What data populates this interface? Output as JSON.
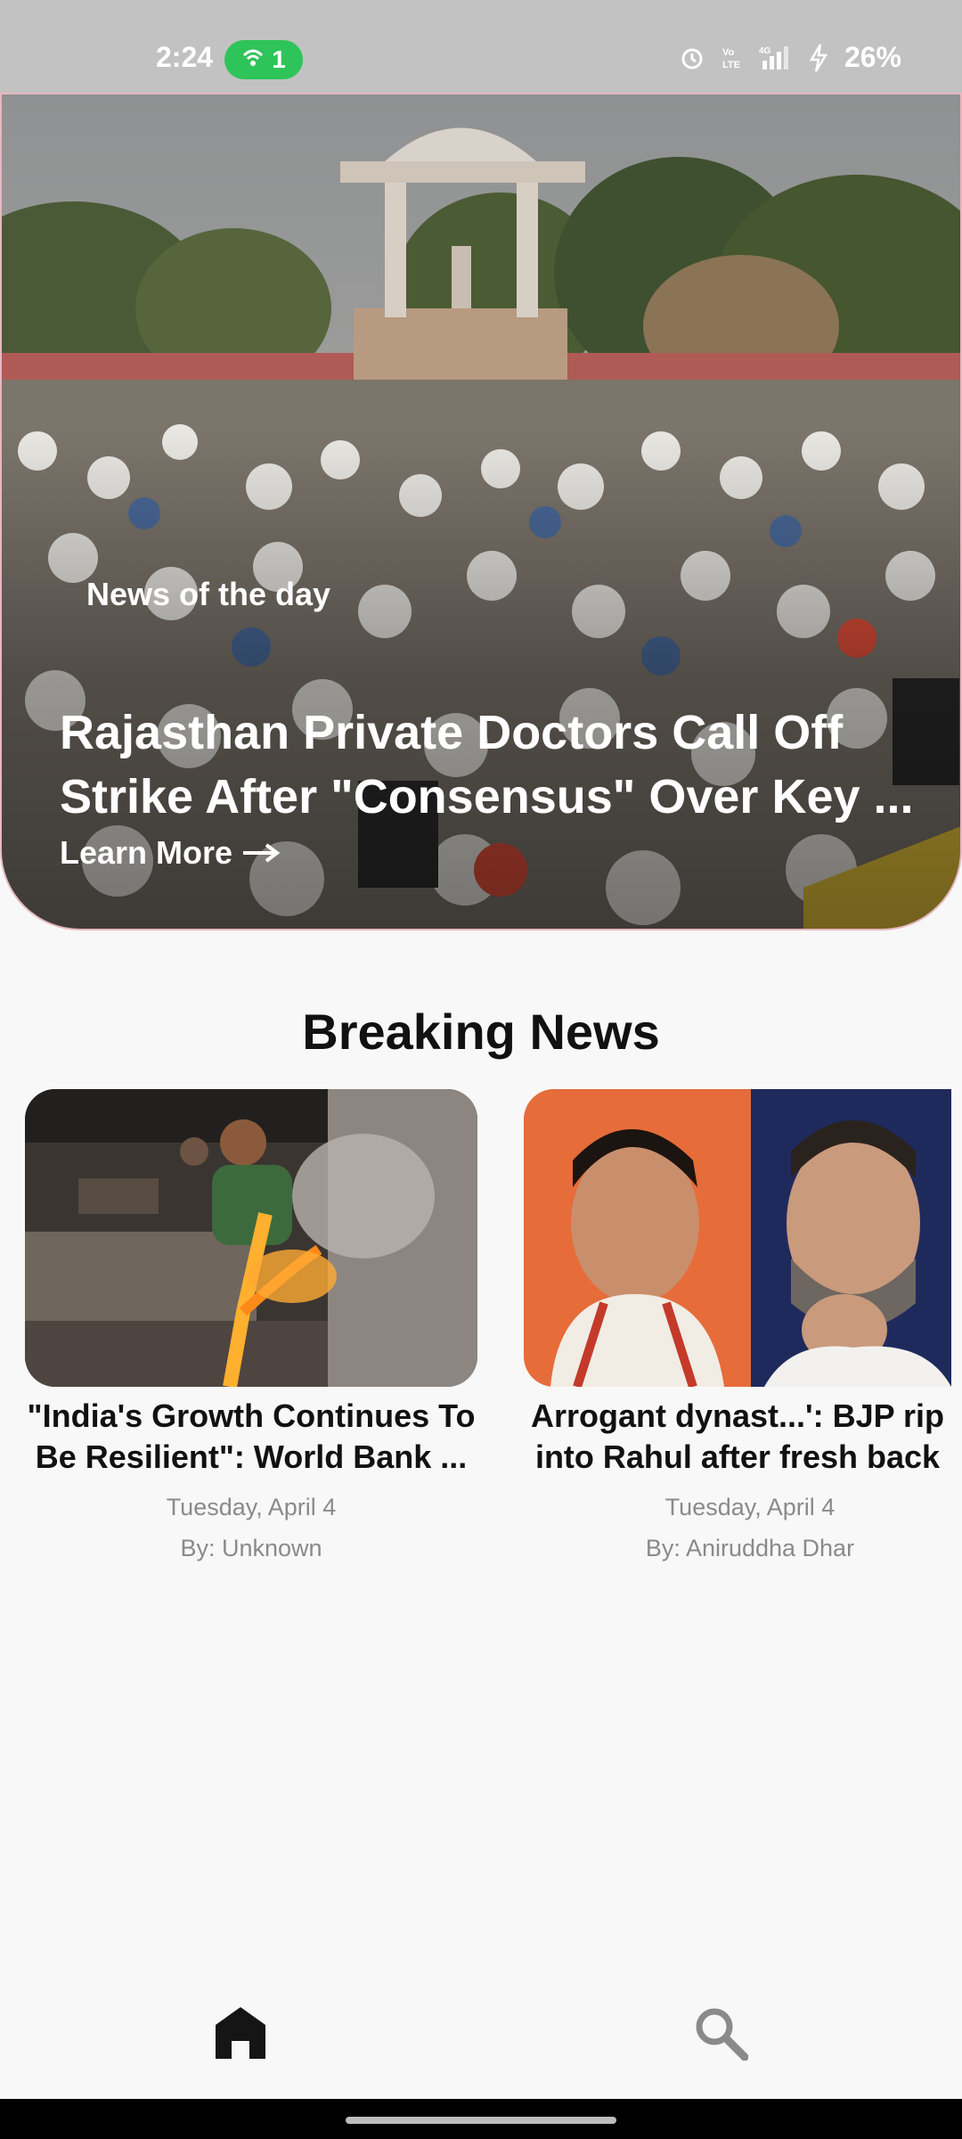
{
  "status_bar": {
    "time": "2:24",
    "hotspot_count": "1",
    "battery": "26%",
    "network": "4G"
  },
  "hero": {
    "kicker": "News of the day",
    "title": "Rajasthan Private Doctors Call Off Strike After \"Consensus\" Over Key ...",
    "link": "Learn More"
  },
  "breaking": {
    "section_title": "Breaking News",
    "cards": [
      {
        "title_line1": "\"India's Growth Continues To",
        "title_line2": "Be Resilient\": World Bank ...",
        "date": "Tuesday, April 4",
        "author": "By: Unknown"
      },
      {
        "title_line1": "Arrogant dynast...': BJP rip",
        "title_line2": "into Rahul after fresh back",
        "date": "Tuesday, April 4",
        "author": "By: Aniruddha Dhar"
      }
    ]
  },
  "nav": {
    "items": [
      "home-icon",
      "search-icon"
    ]
  },
  "colors": {
    "status_bg": "#c2c2c2",
    "hotspot": "#2ec45a",
    "page_bg": "#f8f8f8"
  }
}
